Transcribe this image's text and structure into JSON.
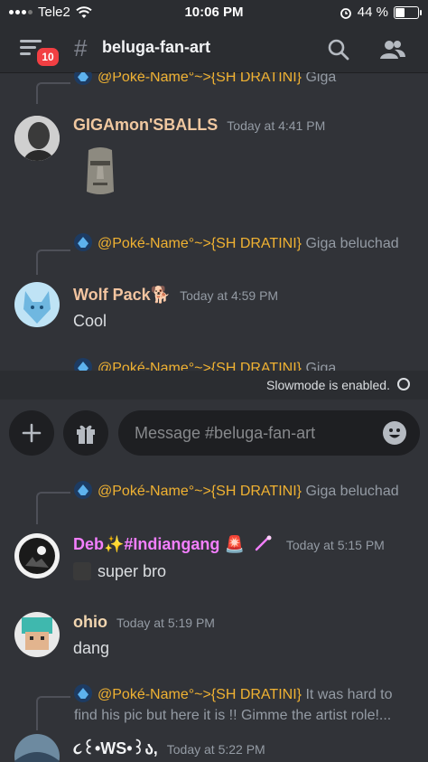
{
  "status_bar": {
    "carrier": "Tele2",
    "time": "10:06 PM",
    "battery_percent": "44 %",
    "battery_level": 0.44
  },
  "header": {
    "unread_badge": "10",
    "channel_name": "beluga-fan-art",
    "hash_symbol": "#"
  },
  "colors": {
    "accent_mention": "#f0b232",
    "badge": "#f23f43"
  },
  "messages_top": [
    {
      "reply": {
        "name": "@Poké-Name°~>{SH DRATINI}",
        "text": "Giga"
      }
    },
    {
      "author": "GIGAmon'SBALLS",
      "timestamp": "Today at 4:41 PM",
      "content": ""
    },
    {
      "reply": {
        "name": "@Poké-Name°~>{SH DRATINI}",
        "text": "Giga beluchad"
      }
    },
    {
      "author": "Wolf Pack",
      "author_emoji": "🐕",
      "timestamp": "Today at 4:59 PM",
      "content": "Cool"
    },
    {
      "reply": {
        "name": "@Poké-Name°~>{SH DRATINI}",
        "text": "Giga"
      }
    }
  ],
  "slowmode": {
    "text": "Slowmode is enabled."
  },
  "composer": {
    "placeholder": "Message #beluga-fan-art"
  },
  "messages_bottom": [
    {
      "reply": {
        "name": "@Poké-Name°~>{SH DRATINI}",
        "text": "Giga beluchad"
      }
    },
    {
      "author": "Deb✨#Indiangang",
      "author_emoji": "🚨",
      "timestamp": "Today at 5:15 PM",
      "content": "super bro"
    },
    {
      "author": "ohio",
      "timestamp": "Today at 5:19 PM",
      "content": "dang"
    },
    {
      "reply": {
        "name": "@Poké-Name°~>{SH DRATINI}",
        "text": "It was hard to find his pic but here it is !! Gimme the artist role!..."
      }
    },
    {
      "author": "૮꒰•WS•꒱ა,",
      "timestamp": "Today at 5:22 PM"
    }
  ]
}
